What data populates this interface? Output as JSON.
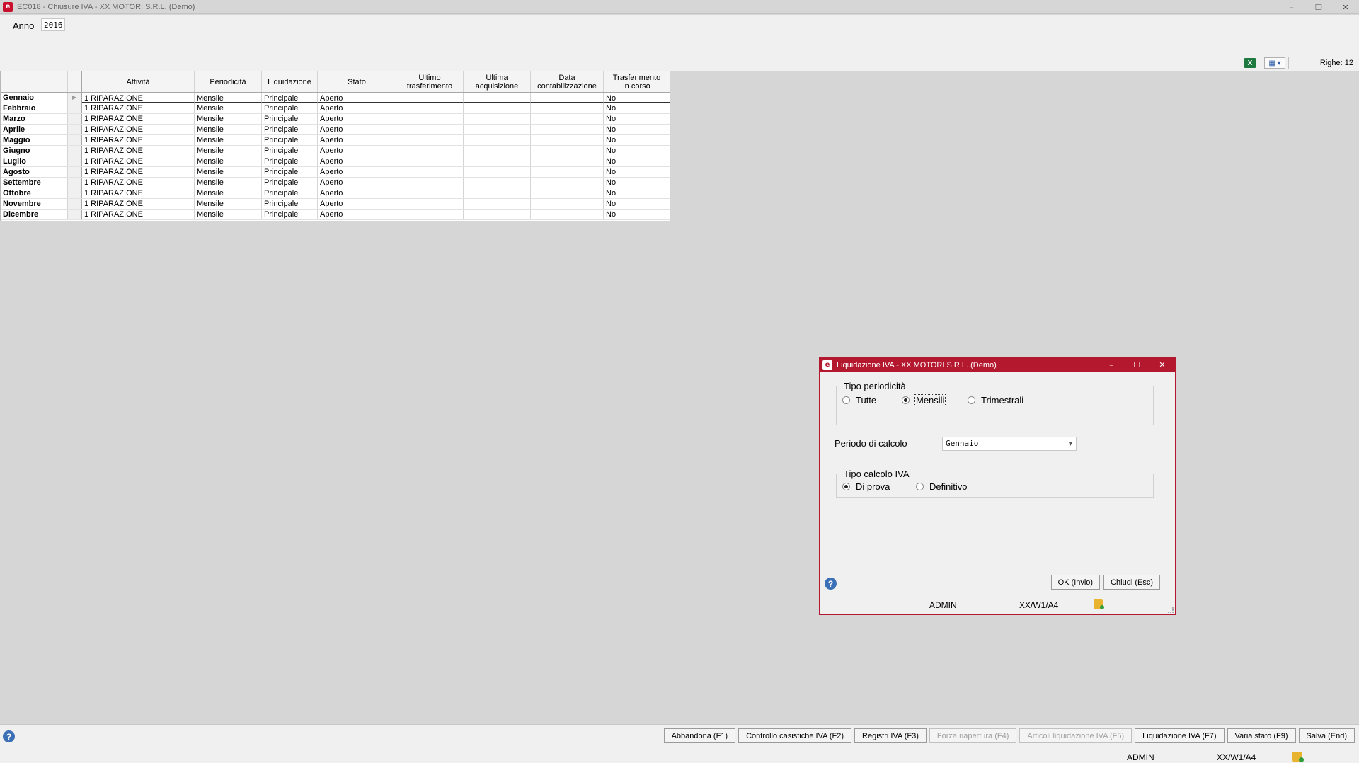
{
  "window": {
    "title": "EC018 - Chiusure IVA - XX  MOTORI S.R.L.  (Demo)",
    "icon": "app-logo-icon"
  },
  "form": {
    "anno_label": "Anno",
    "anno_value": "2016"
  },
  "toolbar": {
    "excel_icon": "excel-icon",
    "view_icon": "grid-view-icon",
    "righe": "Righe: 12"
  },
  "grid": {
    "columns": [
      "Attività",
      "Periodicità",
      "Liquidazione",
      "Stato",
      "Ultimo\ntrasferimento",
      "Ultima\nacquisizione",
      "Data\ncontabilizzazione",
      "Trasferimento\nin corso"
    ],
    "rows": [
      {
        "month": "Gennaio",
        "attivita": "1 RIPARAZIONE",
        "periodicita": "Mensile",
        "liquidazione": "Principale",
        "stato": "Aperto",
        "ultimo": "",
        "ultima": "",
        "data": "",
        "trasferimento": "No"
      },
      {
        "month": "Febbraio",
        "attivita": "1 RIPARAZIONE",
        "periodicita": "Mensile",
        "liquidazione": "Principale",
        "stato": "Aperto",
        "ultimo": "",
        "ultima": "",
        "data": "",
        "trasferimento": "No"
      },
      {
        "month": "Marzo",
        "attivita": "1 RIPARAZIONE",
        "periodicita": "Mensile",
        "liquidazione": "Principale",
        "stato": "Aperto",
        "ultimo": "",
        "ultima": "",
        "data": "",
        "trasferimento": "No"
      },
      {
        "month": "Aprile",
        "attivita": "1 RIPARAZIONE",
        "periodicita": "Mensile",
        "liquidazione": "Principale",
        "stato": "Aperto",
        "ultimo": "",
        "ultima": "",
        "data": "",
        "trasferimento": "No"
      },
      {
        "month": "Maggio",
        "attivita": "1 RIPARAZIONE",
        "periodicita": "Mensile",
        "liquidazione": "Principale",
        "stato": "Aperto",
        "ultimo": "",
        "ultima": "",
        "data": "",
        "trasferimento": "No"
      },
      {
        "month": "Giugno",
        "attivita": "1 RIPARAZIONE",
        "periodicita": "Mensile",
        "liquidazione": "Principale",
        "stato": "Aperto",
        "ultimo": "",
        "ultima": "",
        "data": "",
        "trasferimento": "No"
      },
      {
        "month": "Luglio",
        "attivita": "1 RIPARAZIONE",
        "periodicita": "Mensile",
        "liquidazione": "Principale",
        "stato": "Aperto",
        "ultimo": "",
        "ultima": "",
        "data": "",
        "trasferimento": "No"
      },
      {
        "month": "Agosto",
        "attivita": "1 RIPARAZIONE",
        "periodicita": "Mensile",
        "liquidazione": "Principale",
        "stato": "Aperto",
        "ultimo": "",
        "ultima": "",
        "data": "",
        "trasferimento": "No"
      },
      {
        "month": "Settembre",
        "attivita": "1 RIPARAZIONE",
        "periodicita": "Mensile",
        "liquidazione": "Principale",
        "stato": "Aperto",
        "ultimo": "",
        "ultima": "",
        "data": "",
        "trasferimento": "No"
      },
      {
        "month": "Ottobre",
        "attivita": "1 RIPARAZIONE",
        "periodicita": "Mensile",
        "liquidazione": "Principale",
        "stato": "Aperto",
        "ultimo": "",
        "ultima": "",
        "data": "",
        "trasferimento": "No"
      },
      {
        "month": "Novembre",
        "attivita": "1 RIPARAZIONE",
        "periodicita": "Mensile",
        "liquidazione": "Principale",
        "stato": "Aperto",
        "ultimo": "",
        "ultima": "",
        "data": "",
        "trasferimento": "No"
      },
      {
        "month": "Dicembre",
        "attivita": "1 RIPARAZIONE",
        "periodicita": "Mensile",
        "liquidazione": "Principale",
        "stato": "Aperto",
        "ultimo": "",
        "ultima": "",
        "data": "",
        "trasferimento": "No"
      }
    ]
  },
  "dialog": {
    "title": "Liquidazione IVA - XX  MOTORI S.R.L.  (Demo)",
    "tipo_periodicita": {
      "label": "Tipo periodicità",
      "options": [
        "Tutte",
        "Mensili",
        "Trimestrali"
      ],
      "selected": "Mensili"
    },
    "periodo": {
      "label": "Periodo di calcolo",
      "value": "Gennaio"
    },
    "tipo_calcolo": {
      "label": "Tipo calcolo IVA",
      "options": [
        "Di prova",
        "Definitivo"
      ],
      "selected": "Di prova"
    },
    "ok_label": "OK (Invio)",
    "chiudi_label": "Chiudi (Esc)",
    "status_user": "ADMIN",
    "status_code": "XX/W1/A4"
  },
  "bottom": {
    "buttons": [
      {
        "label": "Abbandona (F1)",
        "enabled": true
      },
      {
        "label": "Controllo casistiche IVA (F2)",
        "enabled": true
      },
      {
        "label": "Registri IVA (F3)",
        "enabled": true
      },
      {
        "label": "Forza riapertura (F4)",
        "enabled": false
      },
      {
        "label": "Articoli liquidazione IVA (F5)",
        "enabled": false
      },
      {
        "label": "Liquidazione IVA (F7)",
        "enabled": true
      },
      {
        "label": "Varia stato (F9)",
        "enabled": true
      },
      {
        "label": "Salva (End)",
        "enabled": true
      }
    ],
    "status_user": "ADMIN",
    "status_code": "XX/W1/A4"
  },
  "colors": {
    "dialog_accent": "#b3182e",
    "help_blue": "#3b6fb6",
    "excel_green": "#1f7a40"
  }
}
